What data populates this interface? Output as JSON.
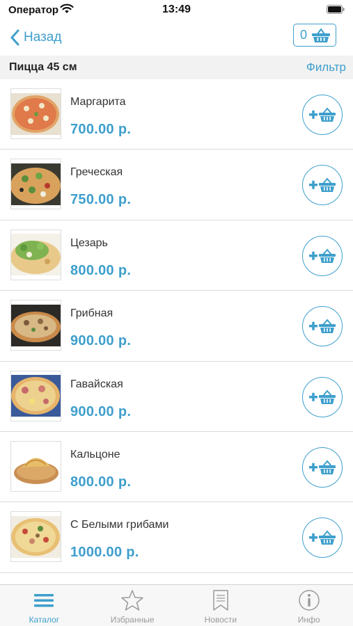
{
  "status_bar": {
    "carrier": "Оператор",
    "time": "13:49"
  },
  "nav": {
    "back_label": "Назад",
    "cart_count": "0"
  },
  "section": {
    "title": "Пицца 45 см",
    "filter_label": "Фильтр"
  },
  "products": [
    {
      "name": "Маргарита",
      "price": "700.00 р."
    },
    {
      "name": "Греческая",
      "price": "750.00 р."
    },
    {
      "name": "Цезарь",
      "price": "800.00 р."
    },
    {
      "name": "Грибная",
      "price": "900.00 р."
    },
    {
      "name": "Гавайская",
      "price": "900.00 р."
    },
    {
      "name": "Кальцоне",
      "price": "800.00 р."
    },
    {
      "name": "С Белыми грибами",
      "price": "1000.00 р."
    }
  ],
  "tabs": [
    {
      "label": "Каталог",
      "icon": "menu-lines-icon",
      "active": true
    },
    {
      "label": "Избранные",
      "icon": "star-icon",
      "active": false
    },
    {
      "label": "Новости",
      "icon": "bookmark-icon",
      "active": false
    },
    {
      "label": "Инфо",
      "icon": "info-icon",
      "active": false
    }
  ],
  "colors": {
    "accent": "#3e9fcc",
    "section_bg": "#f2f2f2",
    "tab_inactive": "#9a9a9a"
  }
}
